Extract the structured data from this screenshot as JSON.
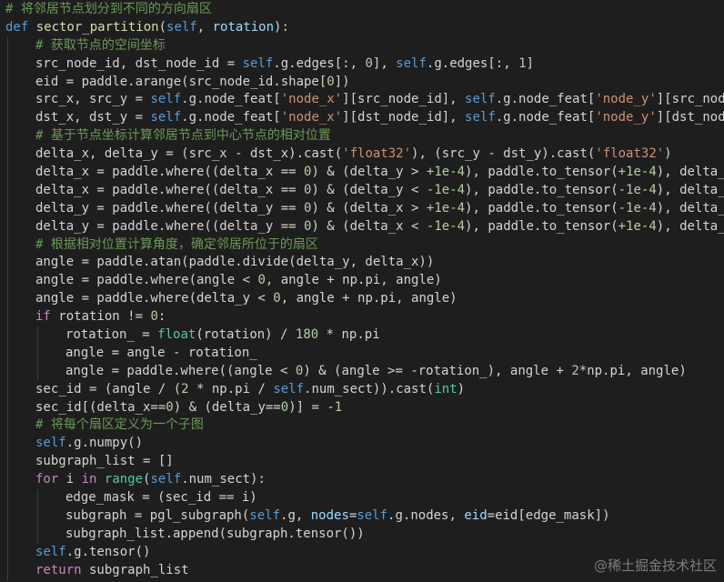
{
  "colors": {
    "background": "#1e1e1e",
    "comment": "#6a9955",
    "keyword": "#c586c0",
    "def_keyword": "#569cd6",
    "function": "#dcdcaa",
    "self": "#569cd6",
    "string": "#ce9178",
    "number": "#b5cea8",
    "param": "#9cdcfe",
    "builtin": "#4ec9b0",
    "plain": "#d4d4d4"
  },
  "watermark": "@稀土掘金技术社区",
  "lines": [
    {
      "indent": 0,
      "tokens": [
        [
          "com",
          "# 将邻居节点划分到不同的方向扇区"
        ]
      ]
    },
    {
      "indent": 0,
      "tokens": [
        [
          "def",
          "def "
        ],
        [
          "fn",
          "sector_partition"
        ],
        [
          "plain",
          "("
        ],
        [
          "self",
          "self"
        ],
        [
          "plain",
          ", "
        ],
        [
          "param",
          "rotation"
        ],
        [
          "plain",
          "):"
        ]
      ]
    },
    {
      "indent": 1,
      "tokens": [
        [
          "com",
          "# 获取节点的空间坐标"
        ]
      ]
    },
    {
      "indent": 1,
      "tokens": [
        [
          "plain",
          "src_node_id, dst_node_id = "
        ],
        [
          "self",
          "self"
        ],
        [
          "plain",
          ".g.edges[:, "
        ],
        [
          "num",
          "0"
        ],
        [
          "plain",
          "], "
        ],
        [
          "self",
          "self"
        ],
        [
          "plain",
          ".g.edges[:, "
        ],
        [
          "num",
          "1"
        ],
        [
          "plain",
          "]"
        ]
      ]
    },
    {
      "indent": 1,
      "tokens": [
        [
          "plain",
          "eid = paddle.arange(src_node_id.shape["
        ],
        [
          "num",
          "0"
        ],
        [
          "plain",
          "])"
        ]
      ]
    },
    {
      "indent": 1,
      "tokens": [
        [
          "plain",
          "src_x, src_y = "
        ],
        [
          "self",
          "self"
        ],
        [
          "plain",
          ".g.node_feat["
        ],
        [
          "str",
          "'node_x'"
        ],
        [
          "plain",
          "][src_node_id], "
        ],
        [
          "self",
          "self"
        ],
        [
          "plain",
          ".g.node_feat["
        ],
        [
          "str",
          "'node_y'"
        ],
        [
          "plain",
          "][src_node_id]"
        ]
      ]
    },
    {
      "indent": 1,
      "tokens": [
        [
          "plain",
          "dst_x, dst_y = "
        ],
        [
          "self",
          "self"
        ],
        [
          "plain",
          ".g.node_feat["
        ],
        [
          "str",
          "'node_x'"
        ],
        [
          "plain",
          "][dst_node_id], "
        ],
        [
          "self",
          "self"
        ],
        [
          "plain",
          ".g.node_feat["
        ],
        [
          "str",
          "'node_y'"
        ],
        [
          "plain",
          "][dst_node_id]"
        ]
      ]
    },
    {
      "indent": 1,
      "tokens": [
        [
          "com",
          "# 基于节点坐标计算邻居节点到中心节点的相对位置"
        ]
      ]
    },
    {
      "indent": 1,
      "tokens": [
        [
          "plain",
          "delta_x, delta_y = (src_x - dst_x).cast("
        ],
        [
          "str",
          "'float32'"
        ],
        [
          "plain",
          "), (src_y - dst_y).cast("
        ],
        [
          "str",
          "'float32'"
        ],
        [
          "plain",
          ")"
        ]
      ]
    },
    {
      "indent": 1,
      "tokens": [
        [
          "plain",
          "delta_x = paddle.where((delta_x == "
        ],
        [
          "num",
          "0"
        ],
        [
          "plain",
          ") & (delta_y > "
        ],
        [
          "num",
          "+1e-4"
        ],
        [
          "plain",
          "), paddle.to_tensor("
        ],
        [
          "num",
          "+1e-4"
        ],
        [
          "plain",
          "), delta_x)"
        ]
      ]
    },
    {
      "indent": 1,
      "tokens": [
        [
          "plain",
          "delta_x = paddle.where((delta_x == "
        ],
        [
          "num",
          "0"
        ],
        [
          "plain",
          ") & (delta_y < "
        ],
        [
          "num",
          "-1e-4"
        ],
        [
          "plain",
          "), paddle.to_tensor("
        ],
        [
          "num",
          "-1e-4"
        ],
        [
          "plain",
          "), delta_x)"
        ]
      ]
    },
    {
      "indent": 1,
      "tokens": [
        [
          "plain",
          "delta_y = paddle.where((delta_y == "
        ],
        [
          "num",
          "0"
        ],
        [
          "plain",
          ") & (delta_x > "
        ],
        [
          "num",
          "+1e-4"
        ],
        [
          "plain",
          "), paddle.to_tensor("
        ],
        [
          "num",
          "-1e-4"
        ],
        [
          "plain",
          "), delta_y)"
        ]
      ]
    },
    {
      "indent": 1,
      "tokens": [
        [
          "plain",
          "delta_y = paddle.where((delta_y == "
        ],
        [
          "num",
          "0"
        ],
        [
          "plain",
          ") & (delta_x < "
        ],
        [
          "num",
          "-1e-4"
        ],
        [
          "plain",
          "), paddle.to_tensor("
        ],
        [
          "num",
          "+1e-4"
        ],
        [
          "plain",
          "), delta_y)"
        ]
      ]
    },
    {
      "indent": 1,
      "tokens": [
        [
          "com",
          "# 根据相对位置计算角度，确定邻居所位于的扇区"
        ]
      ]
    },
    {
      "indent": 1,
      "tokens": [
        [
          "plain",
          "angle = paddle.atan(paddle.divide(delta_y, delta_x))"
        ]
      ]
    },
    {
      "indent": 1,
      "tokens": [
        [
          "plain",
          "angle = paddle.where(angle < "
        ],
        [
          "num",
          "0"
        ],
        [
          "plain",
          ", angle + np.pi, angle)"
        ]
      ]
    },
    {
      "indent": 1,
      "tokens": [
        [
          "plain",
          "angle = paddle.where(delta_y < "
        ],
        [
          "num",
          "0"
        ],
        [
          "plain",
          ", angle + np.pi, angle)"
        ]
      ]
    },
    {
      "indent": 1,
      "tokens": [
        [
          "kw",
          "if"
        ],
        [
          "plain",
          " rotation != "
        ],
        [
          "num",
          "0"
        ],
        [
          "plain",
          ":"
        ]
      ]
    },
    {
      "indent": 2,
      "tokens": [
        [
          "plain",
          "rotation_ = "
        ],
        [
          "builtin",
          "float"
        ],
        [
          "plain",
          "(rotation) / "
        ],
        [
          "num",
          "180"
        ],
        [
          "plain",
          " * np.pi"
        ]
      ]
    },
    {
      "indent": 2,
      "tokens": [
        [
          "plain",
          "angle = angle - rotation_"
        ]
      ]
    },
    {
      "indent": 2,
      "tokens": [
        [
          "plain",
          "angle = paddle.where((angle < "
        ],
        [
          "num",
          "0"
        ],
        [
          "plain",
          ") & (angle >= -rotation_), angle + "
        ],
        [
          "num",
          "2"
        ],
        [
          "plain",
          "*np.pi, angle)"
        ]
      ]
    },
    {
      "indent": 1,
      "tokens": [
        [
          "plain",
          "sec_id = (angle / ("
        ],
        [
          "num",
          "2"
        ],
        [
          "plain",
          " * np.pi / "
        ],
        [
          "self",
          "self"
        ],
        [
          "plain",
          ".num_sect)).cast("
        ],
        [
          "builtin",
          "int"
        ],
        [
          "plain",
          ")"
        ]
      ]
    },
    {
      "indent": 1,
      "tokens": [
        [
          "plain",
          "sec_id[(delta_x=="
        ],
        [
          "num",
          "0"
        ],
        [
          "plain",
          ") & (delta_y=="
        ],
        [
          "num",
          "0"
        ],
        [
          "plain",
          ")] = -"
        ],
        [
          "num",
          "1"
        ]
      ]
    },
    {
      "indent": 1,
      "tokens": [
        [
          "com",
          "# 将每个扇区定义为一个子图"
        ]
      ]
    },
    {
      "indent": 1,
      "tokens": [
        [
          "self",
          "self"
        ],
        [
          "plain",
          ".g.numpy()"
        ]
      ]
    },
    {
      "indent": 1,
      "tokens": [
        [
          "plain",
          "subgraph_list = []"
        ]
      ]
    },
    {
      "indent": 1,
      "tokens": [
        [
          "kw",
          "for"
        ],
        [
          "plain",
          " i "
        ],
        [
          "kw",
          "in"
        ],
        [
          "plain",
          " "
        ],
        [
          "builtin",
          "range"
        ],
        [
          "plain",
          "("
        ],
        [
          "self",
          "self"
        ],
        [
          "plain",
          ".num_sect):"
        ]
      ]
    },
    {
      "indent": 2,
      "tokens": [
        [
          "plain",
          "edge_mask = (sec_id == i)"
        ]
      ]
    },
    {
      "indent": 2,
      "tokens": [
        [
          "plain",
          "subgraph = pgl_subgraph("
        ],
        [
          "self",
          "self"
        ],
        [
          "plain",
          ".g, "
        ],
        [
          "param",
          "nodes"
        ],
        [
          "plain",
          "="
        ],
        [
          "self",
          "self"
        ],
        [
          "plain",
          ".g.nodes, "
        ],
        [
          "param",
          "eid"
        ],
        [
          "plain",
          "=eid[edge_mask])"
        ]
      ]
    },
    {
      "indent": 2,
      "tokens": [
        [
          "plain",
          "subgraph_list.append(subgraph.tensor())"
        ]
      ]
    },
    {
      "indent": 1,
      "tokens": [
        [
          "self",
          "self"
        ],
        [
          "plain",
          ".g.tensor()"
        ]
      ]
    },
    {
      "indent": 1,
      "tokens": [
        [
          "kw",
          "return"
        ],
        [
          "plain",
          " subgraph_list"
        ]
      ]
    }
  ]
}
